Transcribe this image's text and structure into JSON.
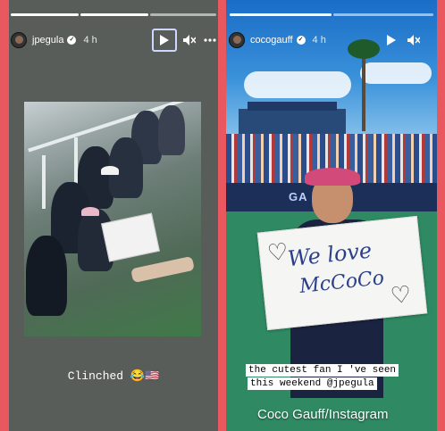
{
  "left_story": {
    "username": "jpegula",
    "time": "4 h",
    "caption": "Clinched 😂🇺🇸",
    "verified_glyph": "✓",
    "icons": {
      "play": "play-icon",
      "mute": "mute-icon",
      "more": "more-icon"
    }
  },
  "right_story": {
    "username": "cocogauff",
    "time": "4 h",
    "verified_glyph": "✓",
    "sign_line1": "We love",
    "sign_line2": "McCoCo",
    "court_wall_text": "GA",
    "caption_line1": "the cutest fan I 've seen",
    "caption_line2": "this weekend  @jpegula"
  },
  "credit": "Coco Gauff/Instagram",
  "colors": {
    "frame": "#e8585e",
    "left_bg": "#585d5a",
    "sky": "#2f80c8"
  }
}
